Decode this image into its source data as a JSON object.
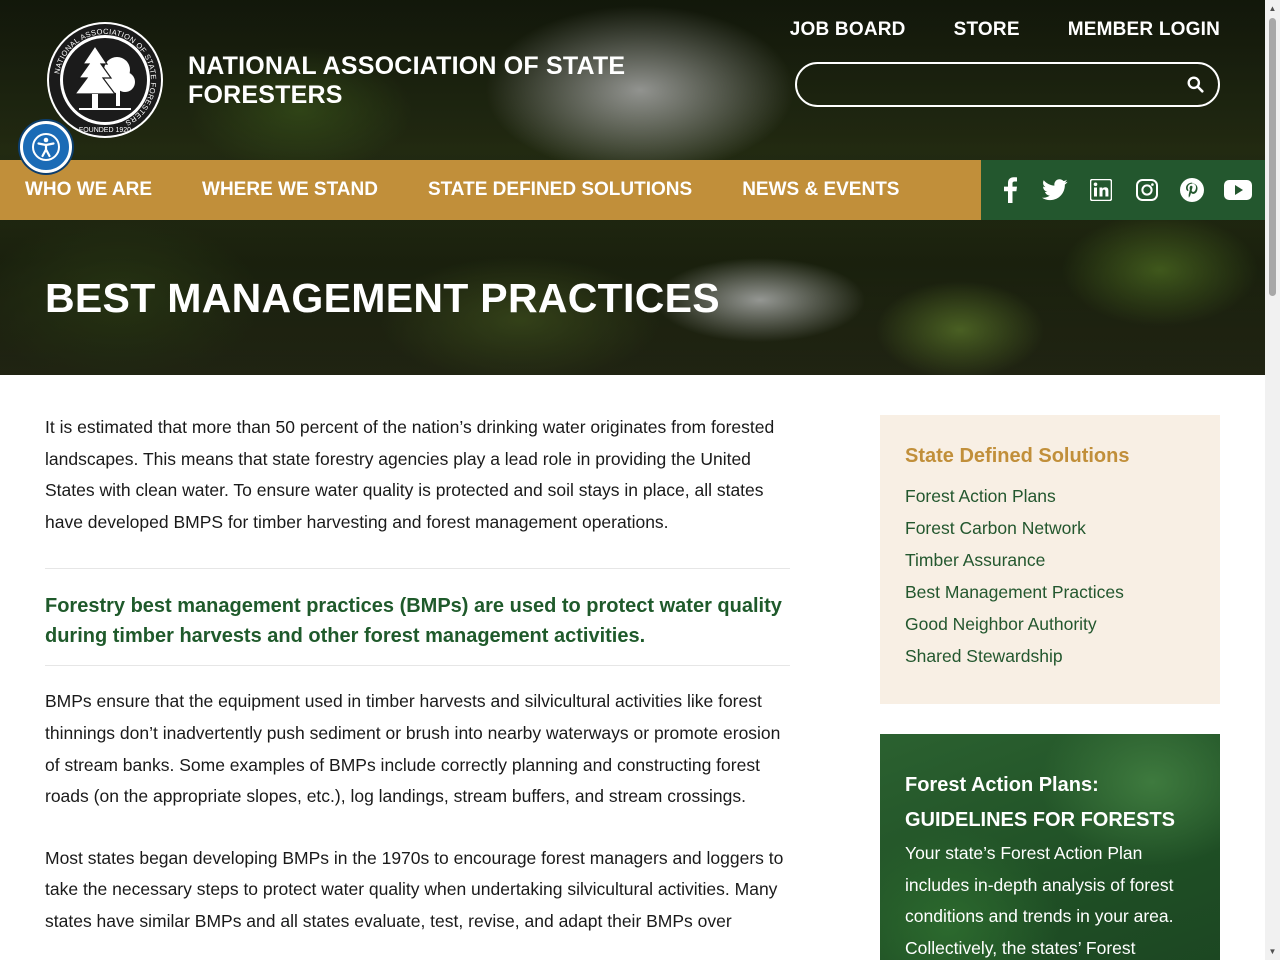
{
  "brand": {
    "site_name": "NATIONAL ASSOCIATION OF STATE FORESTERS",
    "logo_ring_text": "NATIONAL ASSOCIATION OF STATE FORESTERS",
    "logo_founded_text": "FOUNDED 1920"
  },
  "utility_nav": {
    "items": [
      "JOB BOARD",
      "STORE",
      "MEMBER LOGIN"
    ]
  },
  "search": {
    "placeholder": "",
    "value": ""
  },
  "main_nav": {
    "items": [
      "WHO WE ARE",
      "WHERE WE STAND",
      "STATE DEFINED SOLUTIONS",
      "NEWS & EVENTS"
    ]
  },
  "social": {
    "icons": [
      "facebook-icon",
      "twitter-icon",
      "linkedin-icon",
      "instagram-icon",
      "pinterest-icon",
      "youtube-icon"
    ]
  },
  "page": {
    "title": "BEST MANAGEMENT PRACTICES"
  },
  "content": {
    "intro": "It is estimated that more than 50 percent of the nation’s drinking water originates from forested landscapes. This means that state forestry agencies play a lead role in providing the United States with clean water. To ensure water quality is protected and soil stays in place, all states have developed BMPS for timber harvesting and forest management operations.",
    "pull_quote": "Forestry best management practices (BMPs) are used to protect water quality during timber harvests and other forest management activities.",
    "paragraph_2": "BMPs ensure that the equipment used in timber harvests and silvicultural activities like forest thinnings don’t inadvertently push sediment or brush into nearby waterways or promote erosion of stream banks. Some examples of BMPs include correctly planning and constructing forest roads (on the appropriate slopes, etc.), log landings, stream buffers, and stream crossings.",
    "paragraph_3": "Most states began developing BMPs in the 1970s to encourage forest managers and loggers to take the necessary steps to protect water quality when undertaking silvicultural activities. Many states have similar BMPs and all states evaluate, test, revise, and adapt their BMPs over"
  },
  "sidebar": {
    "heading": "State Defined Solutions",
    "links": [
      "Forest Action Plans",
      "Forest Carbon Network",
      "Timber Assurance",
      "Best Management Practices",
      "Good Neighbor Authority",
      "Shared Stewardship"
    ]
  },
  "promo": {
    "title": "Forest Action Plans:",
    "subtitle": "GUIDELINES FOR FORESTS",
    "body": "Your state’s Forest Action Plan includes in-depth analysis of forest conditions and trends in your area. Collectively, the states’ Forest"
  },
  "colors": {
    "gold": "#c18f3a",
    "forest_green": "#23572e",
    "sidebar_bg": "#f8efe4"
  }
}
